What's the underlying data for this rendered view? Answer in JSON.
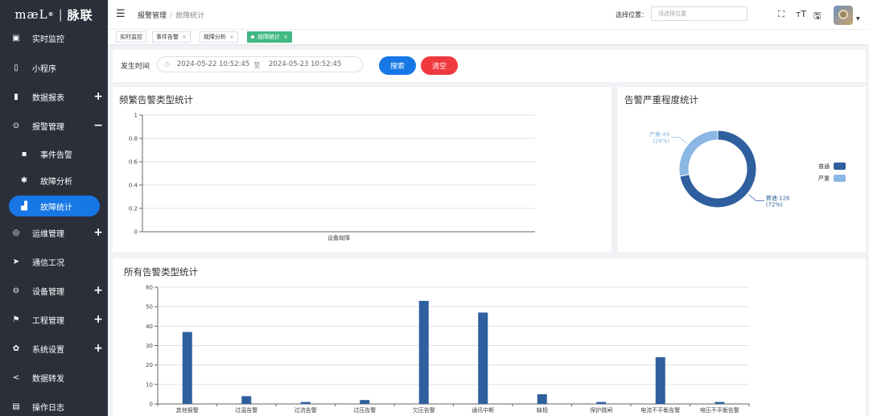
{
  "app": {
    "logo_brand": "mæL",
    "logo_reg": "®",
    "logo_sep": "|",
    "logo_cn": "脉联"
  },
  "sidebar": {
    "items": [
      {
        "label": "实时监控",
        "icon": "image-icon",
        "glyph": "▣",
        "toggle": ""
      },
      {
        "label": "小程序",
        "icon": "mobile-icon",
        "glyph": "▯",
        "toggle": ""
      },
      {
        "label": "数据报表",
        "icon": "book-icon",
        "glyph": "▮",
        "toggle": "+"
      },
      {
        "label": "报警管理",
        "icon": "alarm-icon",
        "glyph": "⊙",
        "toggle": "−"
      },
      {
        "label": "事件告警",
        "icon": "message-icon",
        "glyph": "▪",
        "toggle": "",
        "sub": true
      },
      {
        "label": "故障分析",
        "icon": "bug-icon",
        "glyph": "✱",
        "toggle": "",
        "sub": true
      },
      {
        "label": "故障统计",
        "icon": "bar-chart-icon",
        "glyph": "▟",
        "toggle": "",
        "sub": true,
        "active": true
      },
      {
        "label": "运维管理",
        "icon": "compass-icon",
        "glyph": "◎",
        "toggle": "+"
      },
      {
        "label": "通信工况",
        "icon": "send-icon",
        "glyph": "➤",
        "toggle": ""
      },
      {
        "label": "设备管理",
        "icon": "device-icon",
        "glyph": "⊖",
        "toggle": "+"
      },
      {
        "label": "工程管理",
        "icon": "flag-icon",
        "glyph": "⚑",
        "toggle": "+"
      },
      {
        "label": "系统设置",
        "icon": "gear-icon",
        "glyph": "✿",
        "toggle": "+"
      },
      {
        "label": "数据转发",
        "icon": "share-icon",
        "glyph": "<",
        "toggle": ""
      },
      {
        "label": "操作日志",
        "icon": "log-icon",
        "glyph": "▤",
        "toggle": ""
      }
    ]
  },
  "header": {
    "menu_glyph": "☰",
    "breadcrumb": [
      "报警管理",
      "故障统计"
    ],
    "breadcrumb_sep": "/",
    "location_label": "选择位置：",
    "location_placeholder": "请选择位置",
    "tools": [
      {
        "icon": "fullscreen-icon",
        "glyph": "⛶"
      },
      {
        "icon": "font-size-icon",
        "glyph": "ᴛT"
      },
      {
        "icon": "save-icon",
        "glyph": "🖫"
      }
    ],
    "caret": "▼"
  },
  "tags": [
    {
      "label": "实时监控",
      "closable": false
    },
    {
      "label": "事件告警",
      "closable": true
    },
    {
      "label": "故障分析",
      "closable": true
    },
    {
      "label": "故障统计",
      "closable": true,
      "active": true
    }
  ],
  "tag_close": "×",
  "filter": {
    "label": "发生时间",
    "clock_glyph": "◷",
    "start": "2024-05-22 10:52:45",
    "separator": "至",
    "end": "2024-05-23 10:52:45",
    "search_label": "搜索",
    "clear_label": "清空"
  },
  "chart_data": [
    {
      "type": "bar",
      "title": "频繁告警类型统计",
      "categories": [
        "设备故障"
      ],
      "values": [
        0
      ],
      "ylim": [
        0,
        1
      ],
      "yticks": [
        "0",
        "0.2",
        "0.4",
        "0.6",
        "0.8",
        "1"
      ],
      "grid": true,
      "color": "#2f5f9e"
    },
    {
      "type": "pie",
      "title": "告警严重程度统计",
      "donut": true,
      "slices": [
        {
          "name": "普通",
          "value": 126,
          "label": "普通:126",
          "percent": "(72%)",
          "color": "#2f5f9e"
        },
        {
          "name": "严重",
          "value": 49,
          "label": "严重:49",
          "percent": "(28%)",
          "color": "#8ab7e3"
        }
      ],
      "legend_position": "right"
    },
    {
      "type": "bar",
      "title": "所有告警类型统计",
      "categories": [
        "其他报警",
        "过温告警",
        "过流告警",
        "过压告警",
        "欠压告警",
        "通讯中断",
        "缺相",
        "保护跳闸",
        "电流不平衡告警",
        "电压不平衡告警"
      ],
      "values": [
        37,
        4,
        1,
        2,
        53,
        47,
        5,
        1,
        24,
        1
      ],
      "ylim": [
        0,
        60
      ],
      "yticks": [
        "0",
        "10",
        "20",
        "30",
        "40",
        "50",
        "60"
      ],
      "grid": true,
      "color": "#2f5f9e"
    }
  ]
}
